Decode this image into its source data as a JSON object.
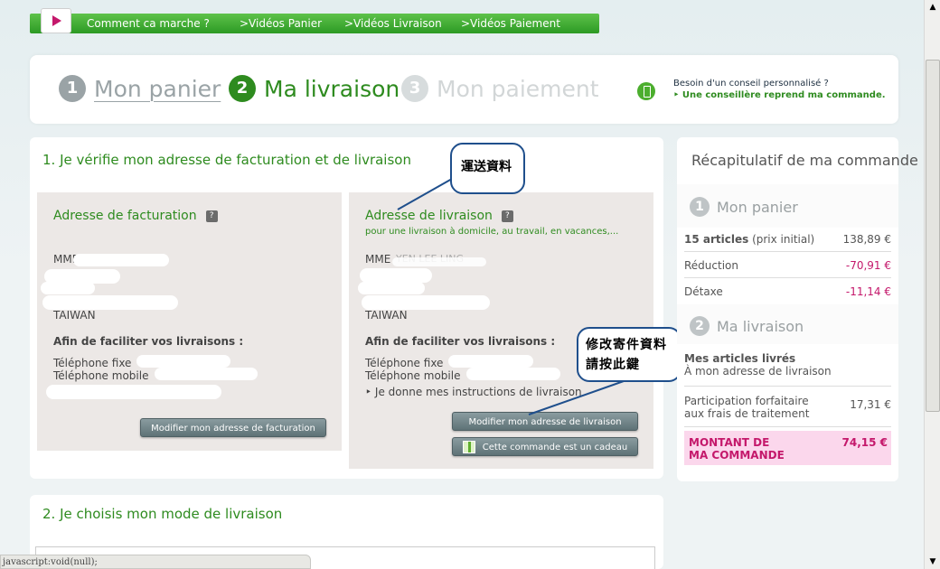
{
  "topnav": {
    "items": [
      "Comment ca marche ?",
      ">Vidéos Panier",
      ">Vidéos Livraison",
      ">Vidéos Paiement"
    ]
  },
  "steps": [
    {
      "num": "1",
      "label": "Mon panier"
    },
    {
      "num": "2",
      "label": "Ma livraison"
    },
    {
      "num": "3",
      "label": "Mon paiement"
    }
  ],
  "help": {
    "line1": "Besoin d'un conseil personnalisé ?",
    "line2": "Une conseillère reprend ma commande."
  },
  "section1": {
    "title": "1. Je vérifie mon adresse de facturation et de livraison",
    "billing": {
      "title": "Adresse de facturation",
      "help": "?",
      "name": "MME",
      "country": "TAIWAN",
      "info_title": "Afin de faciliter vos livraisons :",
      "phone_fixed": "Téléphone fixe",
      "phone_mobile": "Téléphone mobile",
      "button": "Modifier mon adresse de facturation"
    },
    "shipping": {
      "title": "Adresse de livraison",
      "help": "?",
      "subtitle": "pour une livraison à domicile, au travail, en vacances,...",
      "name": "MME",
      "name_partial": "YEN LEE LING",
      "country": "TAIWAN",
      "info_title": "Afin de faciliter vos livraisons :",
      "phone_fixed": "Téléphone fixe",
      "phone_mobile": "Téléphone mobile",
      "instructions": "Je donne mes instructions de livraison",
      "button_modify": "Modifier mon adresse de livraison",
      "button_gift": "Cette commande est un cadeau"
    }
  },
  "callouts": {
    "delivery": "運送資料",
    "modify": "修改寄件資料請按此鍵"
  },
  "recap": {
    "title": "Récapitulatif de ma commande",
    "panier": {
      "num": "1",
      "label": "Mon panier"
    },
    "articles_bold": "15 articles",
    "articles_rest": "(prix initial)",
    "articles_value": "138,89 €",
    "reduction_label": "Réduction",
    "reduction_value": "-70,91 €",
    "detaxe_label": "Détaxe",
    "detaxe_value": "-11,14 €",
    "livraison": {
      "num": "2",
      "label": "Ma livraison"
    },
    "livres_title": "Mes articles livrés",
    "livres_sub": "À mon adresse de livraison",
    "participation_line1": "Participation forfaitaire",
    "participation_line2": "aux frais de traitement",
    "participation_value": "17,31 €",
    "total_line1": "MONTANT DE",
    "total_line2": "MA COMMANDE",
    "total_value": "74,15 €"
  },
  "section2": {
    "title": "2. Je choisis mon mode de livraison"
  },
  "statusbar": "javascript:void(null);"
}
